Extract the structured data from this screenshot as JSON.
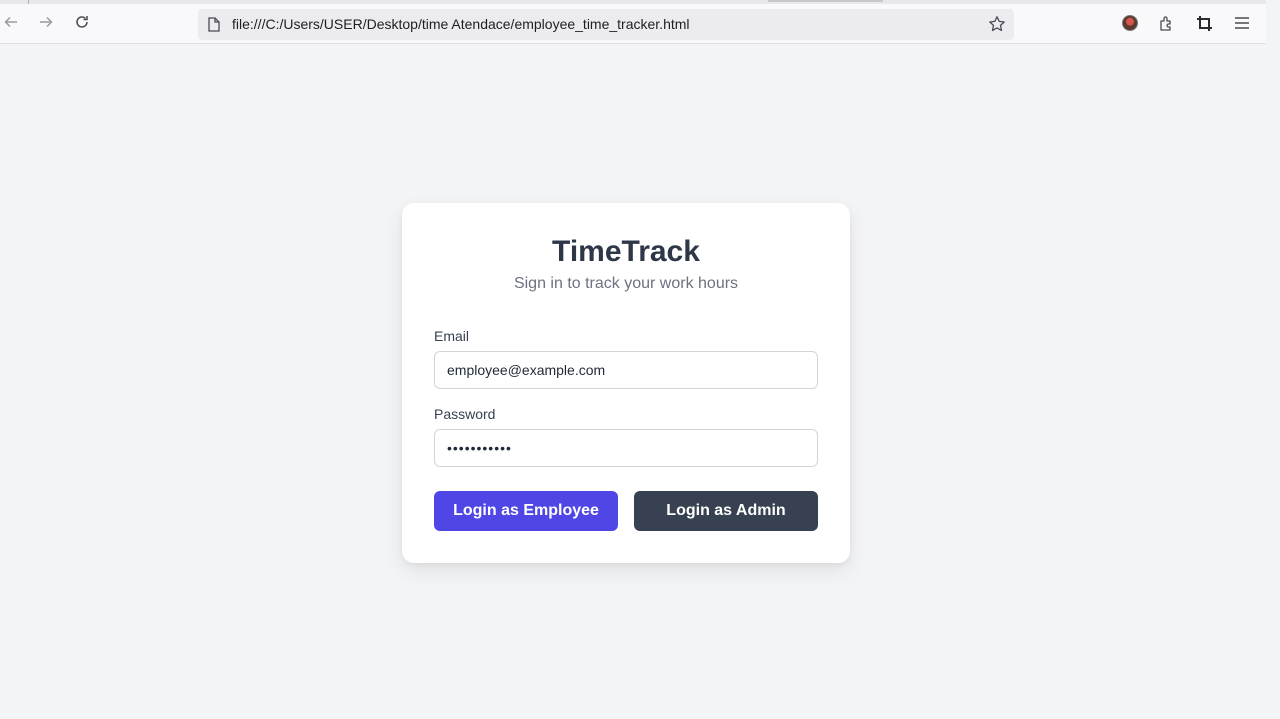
{
  "browser": {
    "url": "file:///C:/Users/USER/Desktop/time Atendace/employee_time_tracker.html"
  },
  "app": {
    "title": "TimeTrack",
    "subtitle": "Sign in to track your work hours"
  },
  "form": {
    "email_label": "Email",
    "email_value": "employee@example.com",
    "password_label": "Password",
    "password_value": "•••••••••••"
  },
  "buttons": {
    "employee_login": "Login as Employee",
    "admin_login": "Login as Admin"
  },
  "colors": {
    "page_bg": "#f3f4f6",
    "card_bg": "#ffffff",
    "employee_button": "#4f46e5",
    "admin_button": "#374151",
    "title_text": "#2d3748",
    "subtitle_text": "#6b7280"
  }
}
